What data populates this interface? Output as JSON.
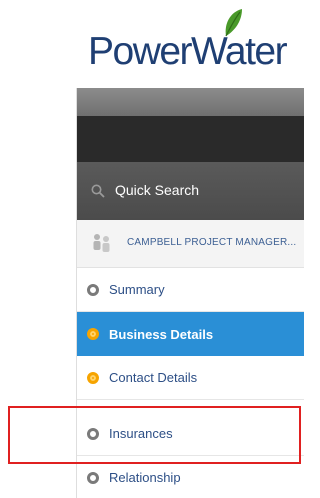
{
  "brand": {
    "name": "PowerWater",
    "leaf_color": "#4a9a2a",
    "text_color": "#1f3f73"
  },
  "sidebar": {
    "search": {
      "label": "Quick Search",
      "icon": "search-icon"
    },
    "profile": {
      "label": "CAMPBELL PROJECT MANAGER...",
      "icon": "users-icon"
    },
    "items": [
      {
        "label": "Summary",
        "status": "gray",
        "active": false
      },
      {
        "label": "Business Details",
        "status": "orange",
        "active": true
      },
      {
        "label": "Contact Details",
        "status": "orange",
        "active": false
      },
      {
        "label": "Insurances",
        "status": "gray",
        "active": false,
        "highlighted": true
      },
      {
        "label": "Relationship",
        "status": "gray",
        "active": false
      }
    ]
  },
  "colors": {
    "active_bg": "#2a8fd6",
    "highlight_border": "#e02020",
    "status_orange": "#f6a400"
  }
}
